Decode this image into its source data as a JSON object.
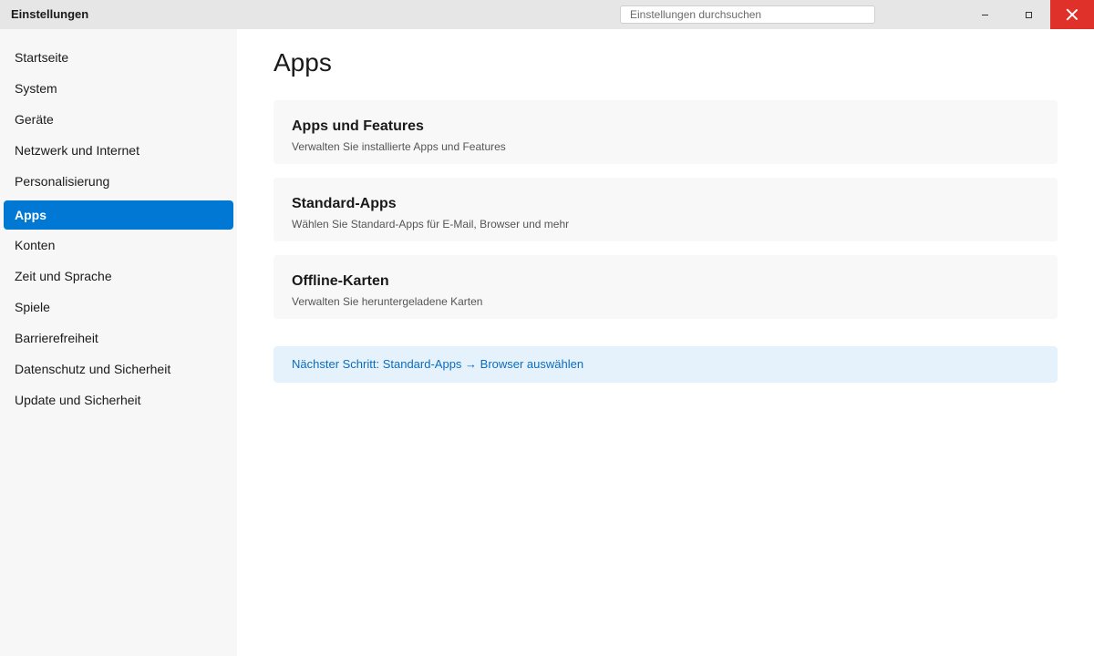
{
  "window": {
    "title": "Einstellungen",
    "search_placeholder": "Einstellungen durchsuchen",
    "controls": {
      "minimize": "–",
      "maximize": "▫",
      "close": "✕"
    },
    "close_color": "#e0302a"
  },
  "sidebar": {
    "items": [
      {
        "label": "Startseite"
      },
      {
        "label": "System"
      },
      {
        "label": "Geräte"
      },
      {
        "label": "Netzwerk und Internet"
      },
      {
        "label": "Personalisierung"
      },
      {
        "label": "Apps",
        "active": true
      },
      {
        "label": "Konten"
      },
      {
        "label": "Zeit und Sprache"
      },
      {
        "label": "Spiele"
      },
      {
        "label": "Barrierefreiheit"
      },
      {
        "label": "Datenschutz und Sicherheit"
      },
      {
        "label": "Update und Sicherheit"
      }
    ],
    "active_color": "#0078d4"
  },
  "main": {
    "title": "Apps",
    "cards": [
      {
        "title": "Apps und Features",
        "description": "Verwalten Sie installierte Apps und Features"
      },
      {
        "title": "Standard-Apps",
        "description": "Wählen Sie Standard-Apps für E-Mail, Browser und mehr"
      },
      {
        "title": "Offline-Karten",
        "description": "Verwalten Sie heruntergeladene Karten"
      }
    ],
    "hint": "Nächster Schritt: Standard-Apps → Browser auswählen",
    "hint_color": "#0b6cbd"
  }
}
